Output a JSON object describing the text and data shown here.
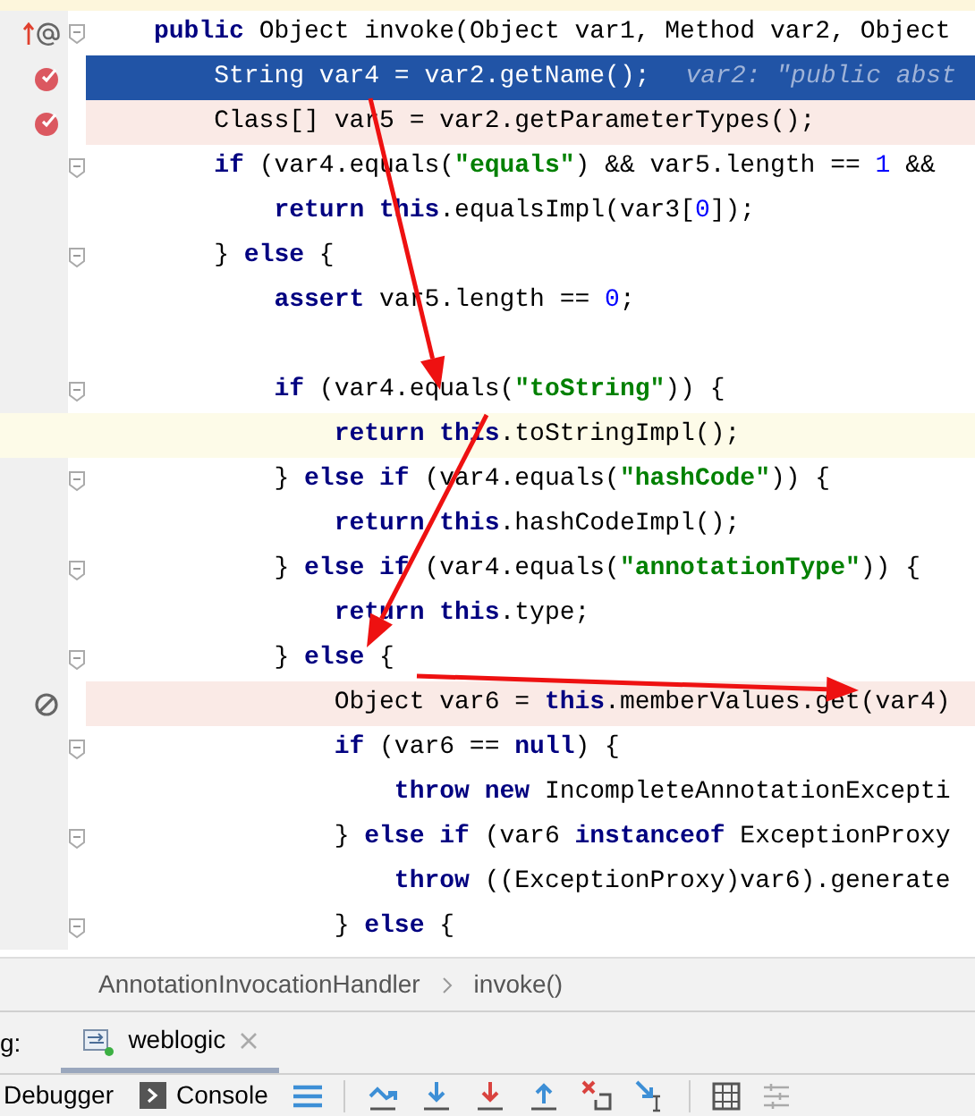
{
  "editor": {
    "lines": [
      {
        "execution_point": false,
        "breakpoint": false,
        "breakpoint_muted": false,
        "caret_line": false,
        "markers": true,
        "fold": true,
        "tokens": [
          {
            "kind": "keyword",
            "text": "public"
          },
          {
            "kind": "plain",
            "text": " Object invoke(Object var1, Method var2, Object"
          }
        ]
      },
      {
        "execution_point": true,
        "breakpoint": true,
        "breakpoint_muted": false,
        "caret_line": false,
        "markers": false,
        "fold": false,
        "tokens": [
          {
            "kind": "plain",
            "text": "    String var4 = var2.getName();"
          },
          {
            "kind": "hint",
            "text": "var2: \"public abst"
          }
        ]
      },
      {
        "execution_point": false,
        "breakpoint": true,
        "breakpoint_muted": false,
        "caret_line": false,
        "markers": false,
        "fold": false,
        "tokens": [
          {
            "kind": "plain",
            "text": "    Class[] var5 = var2.getParameterTypes();"
          }
        ]
      },
      {
        "execution_point": false,
        "breakpoint": false,
        "breakpoint_muted": false,
        "caret_line": false,
        "markers": false,
        "fold": true,
        "tokens": [
          {
            "kind": "keyword",
            "text": "    if"
          },
          {
            "kind": "plain",
            "text": " (var4.equals("
          },
          {
            "kind": "string",
            "text": "\"equals\""
          },
          {
            "kind": "plain",
            "text": ") && var5.length == "
          },
          {
            "kind": "number",
            "text": "1"
          },
          {
            "kind": "plain",
            "text": " &&"
          }
        ]
      },
      {
        "execution_point": false,
        "breakpoint": false,
        "breakpoint_muted": false,
        "caret_line": false,
        "markers": false,
        "fold": false,
        "tokens": [
          {
            "kind": "keyword",
            "text": "        return this"
          },
          {
            "kind": "plain",
            "text": ".equalsImpl(var3["
          },
          {
            "kind": "number",
            "text": "0"
          },
          {
            "kind": "plain",
            "text": "]);"
          }
        ]
      },
      {
        "execution_point": false,
        "breakpoint": false,
        "breakpoint_muted": false,
        "caret_line": false,
        "markers": false,
        "fold": true,
        "tokens": [
          {
            "kind": "plain",
            "text": "    } "
          },
          {
            "kind": "keyword",
            "text": "else"
          },
          {
            "kind": "plain",
            "text": " {"
          }
        ]
      },
      {
        "execution_point": false,
        "breakpoint": false,
        "breakpoint_muted": false,
        "caret_line": false,
        "markers": false,
        "fold": false,
        "tokens": [
          {
            "kind": "keyword",
            "text": "        assert"
          },
          {
            "kind": "plain",
            "text": " var5.length == "
          },
          {
            "kind": "number",
            "text": "0"
          },
          {
            "kind": "plain",
            "text": ";"
          }
        ]
      },
      {
        "execution_point": false,
        "breakpoint": false,
        "breakpoint_muted": false,
        "caret_line": false,
        "markers": false,
        "fold": false
      },
      {
        "execution_point": false,
        "breakpoint": false,
        "breakpoint_muted": false,
        "caret_line": false,
        "markers": false,
        "fold": true,
        "tokens": [
          {
            "kind": "keyword",
            "text": "        if"
          },
          {
            "kind": "plain",
            "text": " (var4.equals("
          },
          {
            "kind": "string",
            "text": "\"toString\""
          },
          {
            "kind": "plain",
            "text": ")) {"
          }
        ]
      },
      {
        "execution_point": false,
        "breakpoint": false,
        "breakpoint_muted": false,
        "caret_line": true,
        "markers": false,
        "fold": false,
        "tokens": [
          {
            "kind": "keyword",
            "text": "            return this"
          },
          {
            "kind": "plain",
            "text": ".toStringImpl();"
          }
        ]
      },
      {
        "execution_point": false,
        "breakpoint": false,
        "breakpoint_muted": false,
        "caret_line": false,
        "markers": false,
        "fold": true,
        "tokens": [
          {
            "kind": "plain",
            "text": "        } "
          },
          {
            "kind": "keyword",
            "text": "else if"
          },
          {
            "kind": "plain",
            "text": " (var4.equals("
          },
          {
            "kind": "string",
            "text": "\"hashCode\""
          },
          {
            "kind": "plain",
            "text": ")) {"
          }
        ]
      },
      {
        "execution_point": false,
        "breakpoint": false,
        "breakpoint_muted": false,
        "caret_line": false,
        "markers": false,
        "fold": false,
        "tokens": [
          {
            "kind": "keyword",
            "text": "            return this"
          },
          {
            "kind": "plain",
            "text": ".hashCodeImpl();"
          }
        ]
      },
      {
        "execution_point": false,
        "breakpoint": false,
        "breakpoint_muted": false,
        "caret_line": false,
        "markers": false,
        "fold": true,
        "tokens": [
          {
            "kind": "plain",
            "text": "        } "
          },
          {
            "kind": "keyword",
            "text": "else if"
          },
          {
            "kind": "plain",
            "text": " (var4.equals("
          },
          {
            "kind": "string",
            "text": "\"annotationType\""
          },
          {
            "kind": "plain",
            "text": ")) {"
          }
        ]
      },
      {
        "execution_point": false,
        "breakpoint": false,
        "breakpoint_muted": false,
        "caret_line": false,
        "markers": false,
        "fold": false,
        "tokens": [
          {
            "kind": "keyword",
            "text": "            return this"
          },
          {
            "kind": "plain",
            "text": ".type;"
          }
        ]
      },
      {
        "execution_point": false,
        "breakpoint": false,
        "breakpoint_muted": false,
        "caret_line": false,
        "markers": false,
        "fold": true,
        "tokens": [
          {
            "kind": "plain",
            "text": "        } "
          },
          {
            "kind": "keyword",
            "text": "else"
          },
          {
            "kind": "plain",
            "text": " {"
          }
        ]
      },
      {
        "execution_point": false,
        "breakpoint": false,
        "breakpoint_muted": true,
        "caret_line": false,
        "markers": false,
        "fold": false,
        "tokens": [
          {
            "kind": "plain",
            "text": "            Object var6 = "
          },
          {
            "kind": "keyword",
            "text": "this"
          },
          {
            "kind": "plain",
            "text": ".memberValues.get(var4)"
          }
        ]
      },
      {
        "execution_point": false,
        "breakpoint": false,
        "breakpoint_muted": false,
        "caret_line": false,
        "markers": false,
        "fold": true,
        "tokens": [
          {
            "kind": "keyword",
            "text": "            if"
          },
          {
            "kind": "plain",
            "text": " (var6 == "
          },
          {
            "kind": "keyword",
            "text": "null"
          },
          {
            "kind": "plain",
            "text": ") {"
          }
        ]
      },
      {
        "execution_point": false,
        "breakpoint": false,
        "breakpoint_muted": false,
        "caret_line": false,
        "markers": false,
        "fold": false,
        "tokens": [
          {
            "kind": "keyword",
            "text": "                throw new"
          },
          {
            "kind": "plain",
            "text": " IncompleteAnnotationExcepti"
          }
        ]
      },
      {
        "execution_point": false,
        "breakpoint": false,
        "breakpoint_muted": false,
        "caret_line": false,
        "markers": false,
        "fold": true,
        "tokens": [
          {
            "kind": "plain",
            "text": "            } "
          },
          {
            "kind": "keyword",
            "text": "else if"
          },
          {
            "kind": "plain",
            "text": " (var6 "
          },
          {
            "kind": "keyword",
            "text": "instanceof"
          },
          {
            "kind": "plain",
            "text": " ExceptionProxy"
          }
        ]
      },
      {
        "execution_point": false,
        "breakpoint": false,
        "breakpoint_muted": false,
        "caret_line": false,
        "markers": false,
        "fold": false,
        "tokens": [
          {
            "kind": "keyword",
            "text": "                throw"
          },
          {
            "kind": "plain",
            "text": " ((ExceptionProxy)var6).generate"
          }
        ]
      },
      {
        "execution_point": false,
        "breakpoint": false,
        "breakpoint_muted": false,
        "caret_line": false,
        "markers": false,
        "fold": true,
        "tokens": [
          {
            "kind": "plain",
            "text": "            } "
          },
          {
            "kind": "keyword",
            "text": "else"
          },
          {
            "kind": "plain",
            "text": " {"
          }
        ]
      }
    ]
  },
  "breadcrumbs": [
    "AnnotationInvocationHandler",
    "invoke()"
  ],
  "debug_bar": {
    "label": "g:",
    "tabs": [
      {
        "label": "weblogic",
        "selected": true
      }
    ]
  },
  "toolbar": {
    "tabs": [
      {
        "label": "Debugger",
        "kind": "plain"
      },
      {
        "label": "Console",
        "kind": "console"
      }
    ]
  }
}
